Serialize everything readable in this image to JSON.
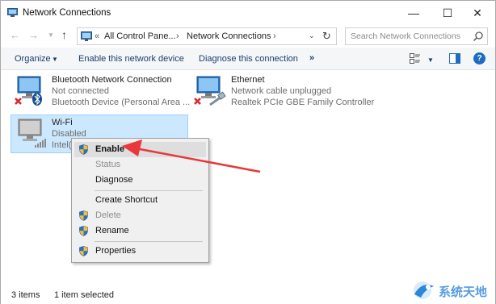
{
  "window": {
    "title": "Network Connections",
    "controls": {
      "minimize": "—",
      "maximize": "☐",
      "close": "✕"
    }
  },
  "nav": {
    "back": "←",
    "forward": "→",
    "up": "↑",
    "address": {
      "prefix": "«",
      "segments": [
        "All Control Pane...",
        "Network Connections"
      ],
      "separator": "›"
    },
    "search": {
      "placeholder": "Search Network Connections"
    }
  },
  "commandbar": {
    "organize": "Organize",
    "enable": "Enable this network device",
    "diagnose": "Diagnose this connection",
    "more": "»",
    "help": "?"
  },
  "items": [
    {
      "name": "Bluetooth Network Connection",
      "status": "Not connected",
      "device": "Bluetooth Device (Personal Area ..."
    },
    {
      "name": "Ethernet",
      "status": "Network cable unplugged",
      "device": "Realtek PCIe GBE Family Controller"
    },
    {
      "name": "Wi-Fi",
      "status": "Disabled",
      "device": "Intel("
    }
  ],
  "context_menu": {
    "items": [
      {
        "label": "Enable",
        "enabled": true,
        "bold": true,
        "shield": true,
        "highlighted": true
      },
      {
        "label": "Status",
        "enabled": false
      },
      {
        "label": "Diagnose",
        "enabled": true
      },
      {
        "label": "Create Shortcut",
        "enabled": true
      },
      {
        "label": "Delete",
        "enabled": false,
        "shield": true
      },
      {
        "label": "Rename",
        "enabled": true,
        "shield": true
      },
      {
        "label": "Properties",
        "enabled": true,
        "shield": true
      }
    ]
  },
  "statusbar": {
    "count": "3 items",
    "selected": "1 item selected"
  },
  "watermark": {
    "text": "系统天地"
  },
  "colors": {
    "selection_bg": "#cce8ff",
    "command_text": "#1a3f6e",
    "annotation_arrow": "#e8383d"
  }
}
